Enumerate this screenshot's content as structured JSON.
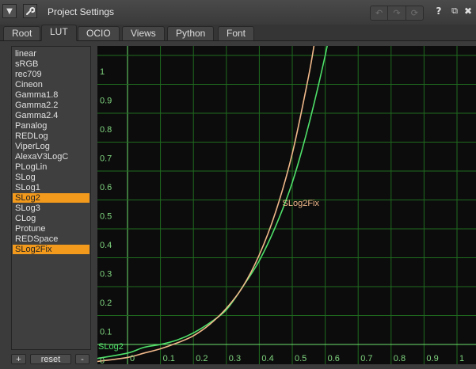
{
  "window": {
    "title": "Project Settings",
    "dropdown_icon": "triangle-down-icon",
    "wrench_icon": "wrench-icon",
    "nav_icons": [
      "back-icon",
      "forward-icon",
      "reload-icon"
    ],
    "help_label": "?",
    "float_label": "⧉",
    "close_label": "✖"
  },
  "tabs": [
    {
      "label": "Root"
    },
    {
      "label": "LUT"
    },
    {
      "label": "OCIO"
    },
    {
      "label": "Views"
    },
    {
      "label": "Python"
    },
    {
      "label": "Font"
    }
  ],
  "active_tab": "LUT",
  "lut_list": {
    "items": [
      {
        "label": "linear"
      },
      {
        "label": "sRGB"
      },
      {
        "label": "rec709"
      },
      {
        "label": "Cineon"
      },
      {
        "label": "Gamma1.8"
      },
      {
        "label": "Gamma2.2"
      },
      {
        "label": "Gamma2.4"
      },
      {
        "label": "Panalog"
      },
      {
        "label": "REDLog"
      },
      {
        "label": "ViperLog"
      },
      {
        "label": "AlexaV3LogC"
      },
      {
        "label": "PLogLin"
      },
      {
        "label": "SLog"
      },
      {
        "label": "SLog1"
      },
      {
        "label": "SLog2"
      },
      {
        "label": "SLog3"
      },
      {
        "label": "CLog"
      },
      {
        "label": "Protune"
      },
      {
        "label": "REDSpace"
      },
      {
        "label": "SLog2Fix"
      }
    ],
    "selected": [
      "SLog2",
      "SLog2Fix"
    ],
    "add_label": "+",
    "reset_label": "reset",
    "remove_label": "-"
  },
  "colors": {
    "selection": "#f39a1c",
    "curve_slog2": "#4fe06a",
    "curve_slog2fix": "#f0b88a",
    "grid": "#1f6b1f",
    "axis": "#6ee06e"
  },
  "chart_data": {
    "type": "line",
    "xlim": [
      0,
      1
    ],
    "ylim": [
      0,
      1
    ],
    "x_ticks": [
      "0",
      "0.1",
      "0.2",
      "0.3",
      "0.4",
      "0.5",
      "0.6",
      "0.7",
      "0.8",
      "0.9",
      "1"
    ],
    "y_ticks": [
      "0",
      "0.1",
      "0.2",
      "0.3",
      "0.4",
      "0.5",
      "0.6",
      "0.7",
      "0.8",
      "0.9",
      "1"
    ],
    "grid": true,
    "series": [
      {
        "name": "SLog2",
        "color": "#4fe06a",
        "points": [
          [
            -0.1,
            -0.05
          ],
          [
            0.0,
            -0.03
          ],
          [
            0.05,
            -0.01
          ],
          [
            0.1,
            0.0
          ],
          [
            0.15,
            0.015
          ],
          [
            0.2,
            0.04
          ],
          [
            0.25,
            0.075
          ],
          [
            0.3,
            0.12
          ],
          [
            0.35,
            0.2
          ],
          [
            0.4,
            0.29
          ],
          [
            0.45,
            0.41
          ],
          [
            0.5,
            0.56
          ],
          [
            0.55,
            0.76
          ],
          [
            0.6,
            1.0
          ],
          [
            0.62,
            1.12
          ]
        ]
      },
      {
        "name": "SLog2Fix",
        "color": "#f0b88a",
        "points": [
          [
            -0.1,
            -0.06
          ],
          [
            0.0,
            -0.045
          ],
          [
            0.05,
            -0.03
          ],
          [
            0.1,
            -0.015
          ],
          [
            0.15,
            0.005
          ],
          [
            0.2,
            0.03
          ],
          [
            0.25,
            0.07
          ],
          [
            0.3,
            0.125
          ],
          [
            0.35,
            0.2
          ],
          [
            0.4,
            0.31
          ],
          [
            0.45,
            0.46
          ],
          [
            0.5,
            0.66
          ],
          [
            0.55,
            0.93
          ],
          [
            0.57,
            1.06
          ],
          [
            0.585,
            1.14
          ]
        ]
      }
    ]
  }
}
